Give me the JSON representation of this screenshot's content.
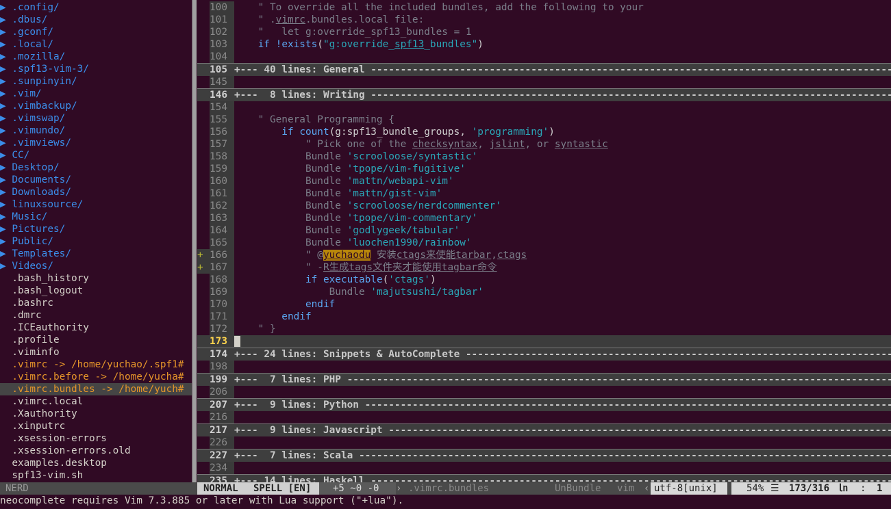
{
  "tree": {
    "dirs": [
      ".config/",
      ".dbus/",
      ".gconf/",
      ".local/",
      ".mozilla/",
      ".spf13-vim-3/",
      ".sunpinyin/",
      ".vim/",
      ".vimbackup/",
      ".vimswap/",
      ".vimundo/",
      ".vimviews/",
      "CC/",
      "Desktop/",
      "Documents/",
      "Downloads/",
      "linuxsource/",
      "Music/",
      "Pictures/",
      "Public/",
      "Templates/",
      "Videos/"
    ],
    "files": [
      ".bash_history",
      ".bash_logout",
      ".bashrc",
      ".dmrc",
      ".ICEauthority",
      ".profile",
      ".viminfo"
    ],
    "links": [
      ".vimrc -> /home/yuchao/.spf1#",
      ".vimrc.before -> /home/yucha#",
      ".vimrc.bundles -> /home/yuch#"
    ],
    "files2": [
      ".vimrc.local",
      ".Xauthority",
      ".xinputrc",
      ".xsession-errors",
      ".xsession-errors.old",
      "examples.desktop",
      "spf13-vim.sh"
    ],
    "dir_marker": "▶"
  },
  "editor": {
    "l100": {
      "n": "100",
      "t": "    \" To override all the included bundles, add the following to your"
    },
    "l101": {
      "n": "101",
      "a": "    \" .",
      "b": "vimrc",
      "c": ".bundles.local file:"
    },
    "l102": {
      "n": "102",
      "t": "    \"   let g:override_spf13_bundles = 1"
    },
    "l103": {
      "n": "103",
      "a": "    if !",
      "b": "exists",
      "c": "(",
      "d": "\"g:override_",
      "e": "spf13",
      "f": "_bundles\"",
      ")": ")"
    },
    "l104": {
      "n": "104"
    },
    "f105": {
      "n": "105",
      "t": "+--- 40 lines: General ------------------------------------------------------------------------------------------------------------"
    },
    "l145": {
      "n": "145"
    },
    "f146": {
      "n": "146",
      "t": "+---  8 lines: Writing ------------------------------------------------------------------------------------------------------------"
    },
    "l154": {
      "n": "154"
    },
    "l155": {
      "n": "155",
      "t": "    \" General Programming {"
    },
    "l156": {
      "n": "156",
      "a": "        if ",
      "b": "count",
      "c": "(g:spf13_bundle_groups, ",
      "d": "'programming'",
      "e": ")"
    },
    "l157": {
      "n": "157",
      "a": "            \" Pick one of the ",
      "b": "checksyntax",
      ",1": ", ",
      "c": "jslint",
      ",2": ", or ",
      "d": "syntastic"
    },
    "l158": {
      "n": "158",
      "k": "            Bundle ",
      "s": "'scrooloose/syntastic'"
    },
    "l159": {
      "n": "159",
      "k": "            Bundle ",
      "s": "'tpope/vim-fugitive'"
    },
    "l160": {
      "n": "160",
      "k": "            Bundle ",
      "s": "'mattn/webapi-vim'"
    },
    "l161": {
      "n": "161",
      "k": "            Bundle ",
      "s": "'mattn/gist-vim'"
    },
    "l162": {
      "n": "162",
      "k": "            Bundle ",
      "s": "'scrooloose/nerdcommenter'"
    },
    "l163": {
      "n": "163",
      "k": "            Bundle ",
      "s": "'tpope/vim-commentary'"
    },
    "l164": {
      "n": "164",
      "k": "            Bundle ",
      "s": "'godlygeek/tabular'"
    },
    "l165": {
      "n": "165",
      "k": "            Bundle ",
      "s": "'luochen1990/rainbow'"
    },
    "l166": {
      "n": "166",
      "sign": "+",
      "a": "            \" @",
      "b": "yuchaodu",
      "c": " 安装",
      "d": "ctags来使能tarbar",
      "e": ",",
      "f": "ctags"
    },
    "l167": {
      "n": "167",
      "sign": "+",
      "a": "            \" -",
      "b": "R生成tags文件夹才能使用tagbar命令"
    },
    "l168": {
      "n": "168",
      "a": "            if ",
      "b": "executable",
      "c": "(",
      "d": "'ctags'",
      "e": ")"
    },
    "l169": {
      "n": "169",
      "k": "                Bundle ",
      "s": "'majutsushi/tagbar'"
    },
    "l170": {
      "n": "170",
      "t": "            endif"
    },
    "l171": {
      "n": "171",
      "t": "        endif"
    },
    "l172": {
      "n": "172",
      "t": "    \" }"
    },
    "l173": {
      "n": "173"
    },
    "f174": {
      "n": "174",
      "t": "+--- 24 lines: Snippets & AutoComplete --------------------------------------------------------------------------------------------"
    },
    "l198": {
      "n": "198"
    },
    "f199": {
      "n": "199",
      "t": "+---  7 lines: PHP ----------------------------------------------------------------------------------------------------------------"
    },
    "l206": {
      "n": "206"
    },
    "f207": {
      "n": "207",
      "t": "+---  9 lines: Python -------------------------------------------------------------------------------------------------------------"
    },
    "l216": {
      "n": "216"
    },
    "f217": {
      "n": "217",
      "t": "+---  9 lines: Javascript ---------------------------------------------------------------------------------------------------------"
    },
    "l226": {
      "n": "226"
    },
    "f227": {
      "n": "227",
      "t": "+---  7 lines: Scala --------------------------------------------------------------------------------------------------------------"
    },
    "l234": {
      "n": "234"
    },
    "f235": {
      "n": "235",
      "t": "+--- 14 lines: Haskell ------------------------------------------------------------------------------------------------------------"
    }
  },
  "status": {
    "nerd": "NERD",
    "mode": "NORMAL",
    "spell": "SPELL [EN]",
    "diff": "+5 ~0 -0",
    "sep": "›",
    "filename": ".vimrc.bundles",
    "func": "UnBundle",
    "ft": "vim",
    "sep2": "‹",
    "encoding": "utf-8[unix]",
    "percent": "54%",
    "lines_icon": "☰",
    "position": "173/316",
    "ln_icon": "㏑",
    "col_sep": ":",
    "col": "1"
  },
  "cmdline": "neocomplete requires Vim 7.3.885 or later with Lua support (\"+lua\").",
  "colors": {
    "background": "#300a24",
    "dir": "#3b8eea",
    "link": "#e5952a",
    "string": "#2aa7b8",
    "comment": "#7b7f8a"
  }
}
